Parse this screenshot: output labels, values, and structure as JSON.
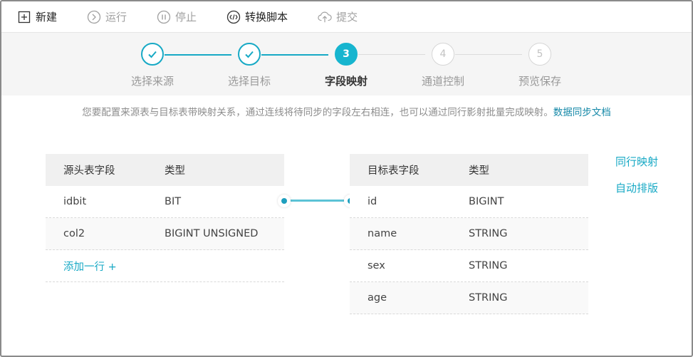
{
  "toolbar": {
    "new_label": "新建",
    "run_label": "运行",
    "stop_label": "停止",
    "convert_label": "转换脚本",
    "submit_label": "提交"
  },
  "steps": [
    {
      "num": "1",
      "label": "选择来源",
      "state": "done"
    },
    {
      "num": "2",
      "label": "选择目标",
      "state": "done"
    },
    {
      "num": "3",
      "label": "字段映射",
      "state": "current"
    },
    {
      "num": "4",
      "label": "通道控制",
      "state": "todo"
    },
    {
      "num": "5",
      "label": "预览保存",
      "state": "todo"
    }
  ],
  "hint": {
    "text": "您要配置来源表与目标表带映射关系，通过连线将待同步的字段左右相连，也可以通过同行影射批量完成映射。",
    "link": "数据同步文档"
  },
  "source_table": {
    "headers": [
      "源头表字段",
      "类型"
    ],
    "rows": [
      [
        "idbit",
        "BIT"
      ],
      [
        "col2",
        "BIGINT UNSIGNED"
      ]
    ],
    "add_row": "添加一行 +"
  },
  "target_table": {
    "headers": [
      "目标表字段",
      "类型"
    ],
    "rows": [
      [
        "id",
        "BIGINT"
      ],
      [
        "name",
        "STRING"
      ],
      [
        "sex",
        "STRING"
      ],
      [
        "age",
        "STRING"
      ]
    ]
  },
  "side_actions": {
    "same_row": "同行映射",
    "auto_layout": "自动排版"
  },
  "colors": {
    "accent": "#17a9c5",
    "step_current": "#17b5cf",
    "connector": "#5cc3d6"
  }
}
